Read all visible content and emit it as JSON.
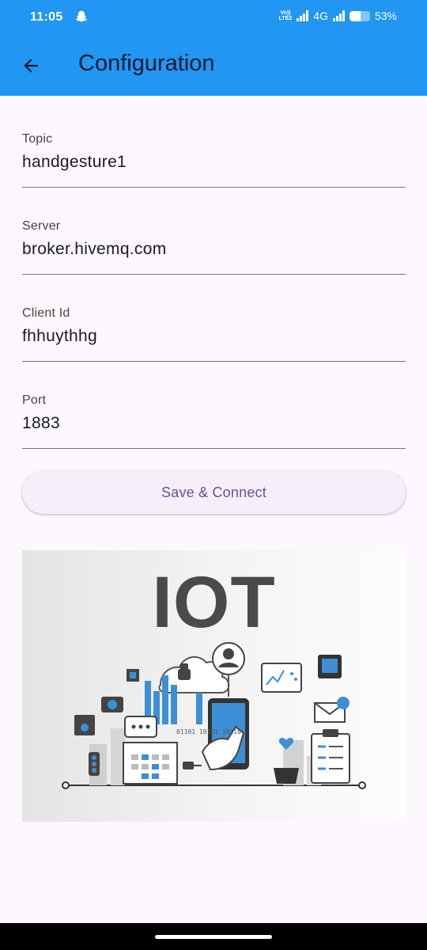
{
  "status_bar": {
    "time": "11:05",
    "volte_top": "Vo))",
    "volte_bottom": "LTE2",
    "network": "4G",
    "battery": "53%",
    "battery_level": 0.53,
    "notification_icon": "snapchat-ghost-icon"
  },
  "app_bar": {
    "title": "Configuration",
    "back_icon": "arrow-back-icon",
    "background_color": "#2196f3"
  },
  "form": {
    "topic": {
      "label": "Topic",
      "value": "handgesture1"
    },
    "server": {
      "label": "Server",
      "value": "broker.hivemq.com"
    },
    "client_id": {
      "label": "Client Id",
      "value": "fhhuythhg"
    },
    "port": {
      "label": "Port",
      "value": "1883"
    },
    "save_label": "Save & Connect",
    "accent_color": "#6750a4"
  },
  "illustration": {
    "title": "IOT",
    "binary_text": "01101 10101 10110"
  }
}
